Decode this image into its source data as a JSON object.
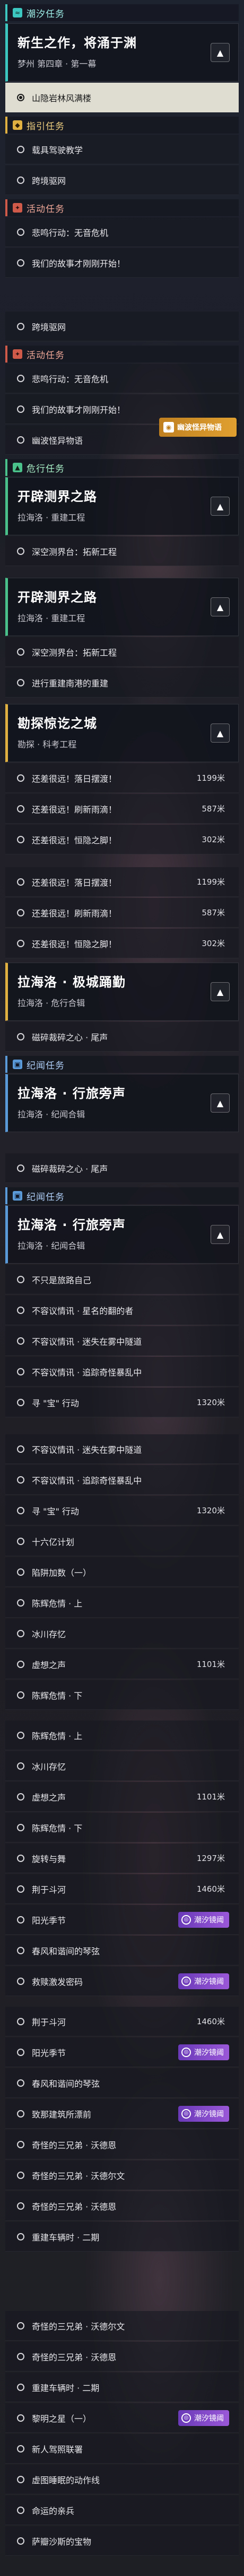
{
  "screen1": {
    "sec_wave": "潮汐任务",
    "card_main": {
      "title": "新生之作，将涌于渊",
      "sub": "梦州 第四章 · 第一幕"
    },
    "item_selected": "山隐岩林风满楼",
    "sec_tutorial": "指引任务",
    "tutorial_items": [
      "载具驾驶教学",
      "跨境驱网"
    ],
    "sec_event": "活动任务",
    "event_items": [
      "悲鸣行动：无音危机",
      "我们的故事才刚刚开始！"
    ],
    "last": "跨境驱网"
  },
  "screen2": {
    "sec_event": "活动任务",
    "event_items": [
      "悲鸣行动：无音危机",
      "我们的故事才刚刚开始！",
      "幽波怪异物语"
    ],
    "tracked_badge": "幽波怪异物语",
    "sec_danger": "危行任务",
    "card": {
      "title": "开辟测界之路",
      "sub": "拉海洛 · 重建工程"
    },
    "items": [
      "深空测界台：拓新工程",
      "进行重建南港的重建"
    ]
  },
  "screen3": {
    "card1": {
      "title": "开辟测界之路",
      "sub": "拉海洛 · 重建工程"
    },
    "items1": [
      "深空测界台：拓新工程",
      "进行重建南港的重建"
    ],
    "card2": {
      "title": "勘探惊讫之城",
      "sub": "勘探 · 科考工程"
    },
    "items2": [
      {
        "label": "还差很远！落日摆渡！",
        "dist": "1199米"
      },
      {
        "label": "还差很远！刷新雨滴！",
        "dist": "587米"
      },
      {
        "label": "还差很远！恒隐之脚！",
        "dist": "302米"
      }
    ]
  },
  "screen4": {
    "items1": [
      {
        "label": "还差很远！落日摆渡！",
        "dist": "1199米"
      },
      {
        "label": "还差很远！刷新雨滴！",
        "dist": "587米"
      },
      {
        "label": "还差很远！恒隐之脚！",
        "dist": "302米"
      }
    ],
    "card": {
      "title": "拉海洛 · 极城踊勤",
      "sub": "拉海洛 · 危行合辑"
    },
    "items2": [
      "磁碎裁碎之心 · 尾声"
    ],
    "sec_side": "纪闻任务",
    "card2": {
      "title": "拉海洛 · 行旅旁声",
      "sub": "拉海洛 · 纪闻合辑"
    }
  },
  "screen5": {
    "items0": [
      "磁碎裁碎之心 · 尾声"
    ],
    "sec_side": "纪闻任务",
    "card": {
      "title": "拉海洛 · 行旅旁声",
      "sub": "拉海洛 · 纪闻合辑"
    },
    "items": [
      {
        "label": "不只是旅路自己",
        "dist": ""
      },
      {
        "label": "不容议情讯 · 星名的翻的者",
        "dist": ""
      },
      {
        "label": "不容议情讯 · 迷失在雾中隧道",
        "dist": ""
      },
      {
        "label": "不容议情讯 · 追踪奇怪暴乱中",
        "dist": ""
      },
      {
        "label": "寻 \"宝\" 行动",
        "dist": "1320米"
      }
    ]
  },
  "screen6": {
    "items": [
      {
        "label": "不容议情讯 · 迷失在雾中隧道",
        "dist": ""
      },
      {
        "label": "不容议情讯 · 追踪奇怪暴乱中",
        "dist": ""
      },
      {
        "label": "寻 \"宝\" 行动",
        "dist": "1320米"
      },
      {
        "label": "十六亿计划",
        "dist": ""
      },
      {
        "label": "陷阱加数（一）",
        "dist": ""
      },
      {
        "label": "陈辉危情 · 上",
        "dist": ""
      },
      {
        "label": "冰川存忆",
        "dist": ""
      },
      {
        "label": "虚想之声",
        "dist": "1101米"
      },
      {
        "label": "陈辉危情 · 下",
        "dist": ""
      }
    ]
  },
  "screen7": {
    "items": [
      {
        "label": "陈辉危情 · 上",
        "dist": ""
      },
      {
        "label": "冰川存忆",
        "dist": ""
      },
      {
        "label": "虚想之声",
        "dist": "1101米"
      },
      {
        "label": "陈辉危情 · 下",
        "dist": ""
      },
      {
        "label": "旋转与舞",
        "dist": "1297米"
      },
      {
        "label": "荆于斗河",
        "dist": "1460米"
      },
      {
        "label": "阳光季节",
        "dist": ""
      },
      {
        "label": "春风和谐间的琴弦",
        "dist": ""
      },
      {
        "label": "救赎激发密码",
        "dist": ""
      }
    ],
    "badge": "潮汐镜阈"
  },
  "screen8": {
    "items": [
      {
        "label": "荆于斗河",
        "dist": "1460米"
      },
      {
        "label": "阳光季节",
        "dist": ""
      },
      {
        "label": "春风和谐间的琴弦",
        "dist": ""
      },
      {
        "label": "致那建筑所漂前",
        "dist": ""
      },
      {
        "label": "奇怪的三兄弟 · 沃德恩",
        "dist": ""
      },
      {
        "label": "奇怪的三兄弟 · 沃德尔文",
        "dist": ""
      },
      {
        "label": "奇怪的三兄弟 · 沃德恩",
        "dist": ""
      },
      {
        "label": "重建车辆时 · 二期",
        "dist": ""
      }
    ],
    "badge": "潮汐镜阈"
  },
  "screen9": {
    "items": [
      {
        "label": "奇怪的三兄弟 · 沃德尔文",
        "dist": ""
      },
      {
        "label": "奇怪的三兄弟 · 沃德恩",
        "dist": ""
      },
      {
        "label": "重建车辆时 · 二期",
        "dist": ""
      },
      {
        "label": "黎明之星（一）",
        "dist": ""
      },
      {
        "label": "新人驾照联署",
        "dist": ""
      },
      {
        "label": "虚图睡眠的动作线",
        "dist": ""
      },
      {
        "label": "命运的亲兵",
        "dist": ""
      },
      {
        "label": "萨瓣沙斯的宝物",
        "dist": ""
      }
    ],
    "badge": "潮汐镜阈"
  }
}
